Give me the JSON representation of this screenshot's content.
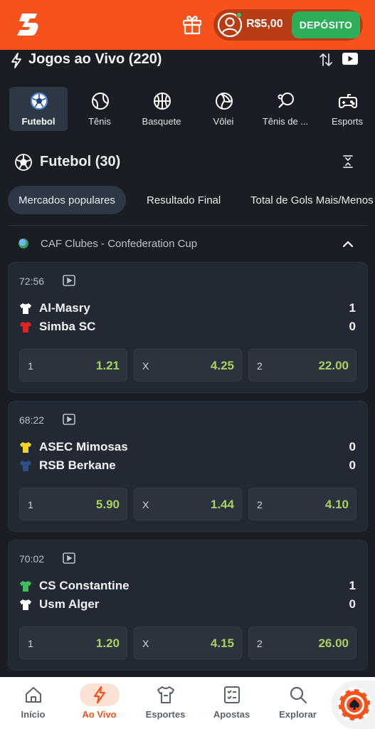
{
  "header": {
    "balance": "R$5,00",
    "deposit_label": "DEPÓSITO",
    "brand_color": "#f7521c"
  },
  "title": "Jogos ao Vivo (220)",
  "sports": [
    {
      "label": "Futebol",
      "icon": "soccer-ball-icon",
      "active": true
    },
    {
      "label": "Tênis",
      "icon": "tennis-ball-icon",
      "active": false
    },
    {
      "label": "Basquete",
      "icon": "basketball-icon",
      "active": false
    },
    {
      "label": "Vôlei",
      "icon": "volleyball-icon",
      "active": false
    },
    {
      "label": "Tênis de ...",
      "icon": "table-tennis-icon",
      "active": false
    },
    {
      "label": "Esports",
      "icon": "gamepad-icon",
      "active": false
    }
  ],
  "section_title": "Futebol (30)",
  "markets": [
    "Mercados populares",
    "Resultado Final",
    "Total de Gols Mais/Menos"
  ],
  "league": "CAF Clubes - Confederation Cup",
  "matches": [
    {
      "time": "72:56",
      "home": {
        "name": "Al-Masry",
        "score": "1",
        "shirt_color": "#ffffff"
      },
      "away": {
        "name": "Simba SC",
        "score": "0",
        "shirt_color": "#e02424"
      },
      "odds": [
        {
          "label": "1",
          "value": "1.21"
        },
        {
          "label": "X",
          "value": "4.25"
        },
        {
          "label": "2",
          "value": "22.00"
        }
      ]
    },
    {
      "time": "68:22",
      "home": {
        "name": "ASEC Mimosas",
        "score": "0",
        "shirt_color": "#f5d328"
      },
      "away": {
        "name": "RSB Berkane",
        "score": "0",
        "shirt_color": "#2d4e86"
      },
      "odds": [
        {
          "label": "1",
          "value": "5.90"
        },
        {
          "label": "X",
          "value": "1.44"
        },
        {
          "label": "2",
          "value": "4.10"
        }
      ]
    },
    {
      "time": "70:02",
      "home": {
        "name": "CS Constantine",
        "score": "1",
        "shirt_color": "#3fbf5a"
      },
      "away": {
        "name": "Usm Alger",
        "score": "0",
        "shirt_color": "#ffffff"
      },
      "odds": [
        {
          "label": "1",
          "value": "1.20"
        },
        {
          "label": "X",
          "value": "4.15"
        },
        {
          "label": "2",
          "value": "26.00"
        }
      ]
    }
  ],
  "bottom_nav": [
    {
      "label": "Início",
      "icon": "home-icon",
      "active": false
    },
    {
      "label": "Ao Vivo",
      "icon": "live-bolt-icon",
      "active": true
    },
    {
      "label": "Esportes",
      "icon": "shirt-icon",
      "active": false
    },
    {
      "label": "Apostas",
      "icon": "betslip-icon",
      "active": false
    },
    {
      "label": "Explorar",
      "icon": "search-icon",
      "active": false
    }
  ]
}
